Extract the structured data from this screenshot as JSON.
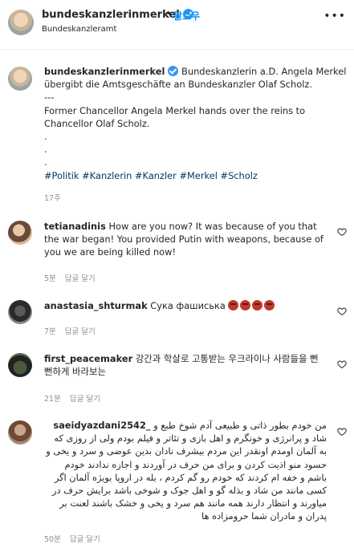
{
  "header": {
    "username": "bundeskanzlerinmerkel",
    "dot": "•",
    "follow_label": "팔로우",
    "subtitle": "Bundeskanzleramt",
    "more": "•••"
  },
  "caption": {
    "username": "bundeskanzlerinmerkel",
    "text_de": "Bundeskanzlerin a.D. Angela Merkel übergibt die Amtsgeschäfte an Bundeskanzler Olaf Scholz.",
    "separator": "---",
    "text_en": "Former Chancellor Angela Merkel hands over the reins to Chancellor Olaf Scholz.",
    "dots": [
      ".",
      ".",
      "."
    ],
    "hashtags": "#Politik #Kanzlerin #Kanzler #Merkel #Scholz",
    "time": "17주"
  },
  "comments": [
    {
      "username": "tetianadinis",
      "text": "How are you now? It was because of you that the war began! You provided Putin with weapons, because of you we are being killed now!",
      "time": "5분",
      "reply": "답글 달기"
    },
    {
      "username": "anastasia_shturmak",
      "text": "Сука фашиська",
      "emoji_count": 4,
      "time": "7분",
      "reply": "답글 달기"
    },
    {
      "username": "first_peacemaker",
      "text": "강간과 학살로 고통받는 우크라이나 사람들을 뻔뻔하게 바라보는",
      "time": "21분",
      "reply": "답글 달기"
    },
    {
      "username": "saeidyazdani2542_",
      "text": "من خودم بطور ذاتی و طبیعی آدم شوخ طبع و شاد و پرانرژی و خونگرم و اهل بازی و تئاتر و فیلم بودم ولی از روزی که به آلمان اومدم اونقدر این مردم بیشرف نادان بدین عوضی و سرد و یخی و حسود منو اذیت کردن و برای من حرف در آوردند و اجازه ندادند خودم باشم و خفه ام کردند که خودم رو گم کردم ، بله در اروپا بویژه آلمان اگر کسی مانند من شاد و بذله گو و اهل جوک و شوخی باشد برایش حرف در میاورند و انتظار دارند همه مانند هم سرد و یخی و خشک باشند لعنت بر پدران و مادران شما حرومزاده ها",
      "time": "50분",
      "reply": "답글 달기"
    }
  ]
}
